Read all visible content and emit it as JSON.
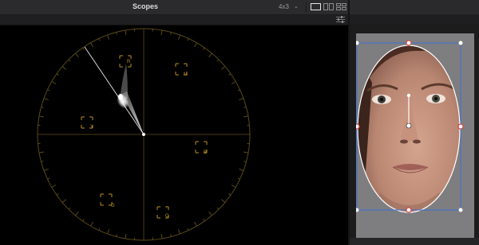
{
  "panel": {
    "title": "Scopes",
    "aspect_ratio": "4x3",
    "aspect_dropdown_icon": "chevron-down-icon",
    "layout_buttons": [
      "single-layout-icon",
      "dual-layout-icon",
      "quad-layout-icon"
    ],
    "settings_icon": "scope-settings-icon"
  },
  "vectorscope": {
    "targets": [
      {
        "id": "R",
        "label": "R"
      },
      {
        "id": "Mg",
        "label": "M"
      },
      {
        "id": "B",
        "label": "B"
      },
      {
        "id": "Cy",
        "label": "C"
      },
      {
        "id": "G",
        "label": "G"
      },
      {
        "id": "Yl",
        "label": "Y"
      }
    ],
    "graticule_color": "#5a4a18",
    "target_color": "#b8901e",
    "skin_tone_line": true,
    "trace_color": "#ffffff"
  },
  "viewer": {
    "background": "#7e7e80",
    "window_shape": "ellipse",
    "window_outline_color": "#ffffff",
    "selection_box_color": "#3d6fd6",
    "handle_color": "#d64545",
    "subject": "face"
  }
}
